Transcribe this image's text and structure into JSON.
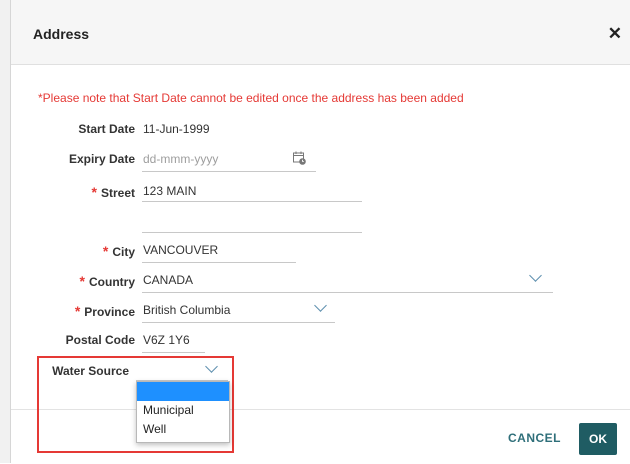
{
  "dialog": {
    "title": "Address",
    "close_icon": "close-icon",
    "notice": "*Please note that Start Date cannot be edited once the address has been added"
  },
  "form": {
    "required_marker": "*",
    "start_date": {
      "label": "Start Date",
      "value": "11-Jun-1999"
    },
    "expiry_date": {
      "label": "Expiry Date",
      "placeholder": "dd-mmm-yyyy",
      "value": "",
      "icon": "calendar-icon"
    },
    "street": {
      "label": "Street",
      "value": "123 MAIN",
      "value2": "",
      "required": true
    },
    "city": {
      "label": "City",
      "value": "VANCOUVER",
      "required": true
    },
    "country": {
      "label": "Country",
      "value": "CANADA",
      "required": true
    },
    "province": {
      "label": "Province",
      "value": "British Columbia",
      "required": true
    },
    "postal_code": {
      "label": "Postal Code",
      "value": "V6Z 1Y6"
    },
    "water_source": {
      "label": "Water Source",
      "value": "",
      "options": [
        "",
        "Municipal",
        "Well"
      ]
    }
  },
  "footer": {
    "cancel_label": "CANCEL",
    "ok_label": "OK"
  },
  "colors": {
    "required": "#e53935",
    "primary": "#1f5c63",
    "highlight": "#1e90ff"
  }
}
